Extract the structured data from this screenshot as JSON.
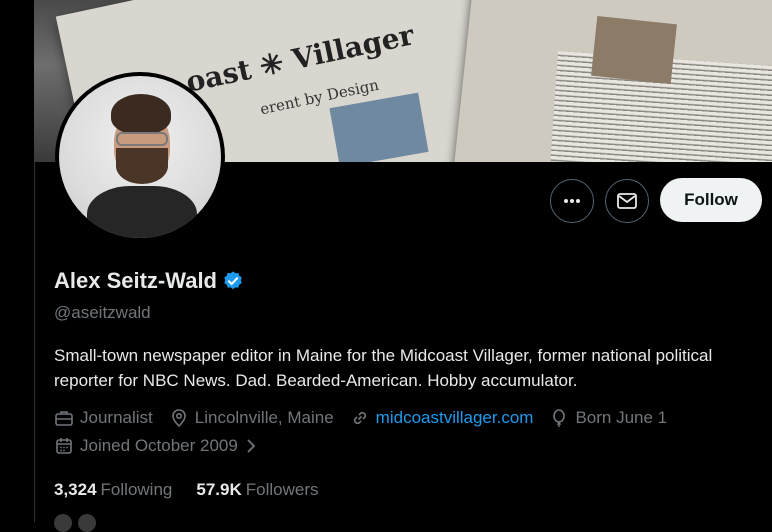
{
  "banner": {
    "masthead": "oast ✳ Villager",
    "subhead": "erent by Design"
  },
  "profile": {
    "name": "Alex Seitz-Wald",
    "handle": "@aseitzwald",
    "bio": "Small-town newspaper editor in Maine for the Midcoast Villager, former national political reporter for NBC News. Dad. Bearded-American. Hobby accumulator.",
    "verified_color": "#1d9bf0"
  },
  "actions": {
    "more_icon": "more-icon",
    "message_icon": "mail-icon",
    "follow_label": "Follow"
  },
  "meta": {
    "profession": "Journalist",
    "location": "Lincolnville, Maine",
    "website": "midcoastvillager.com",
    "birthday": "Born June 1",
    "joined": "Joined October 2009"
  },
  "stats": {
    "following_count": "3,324",
    "following_label": "Following",
    "followers_count": "57.9K",
    "followers_label": "Followers"
  },
  "colors": {
    "background": "#000000",
    "muted": "#71767b",
    "link": "#1d9bf0",
    "follow_bg": "#eff3f4"
  }
}
